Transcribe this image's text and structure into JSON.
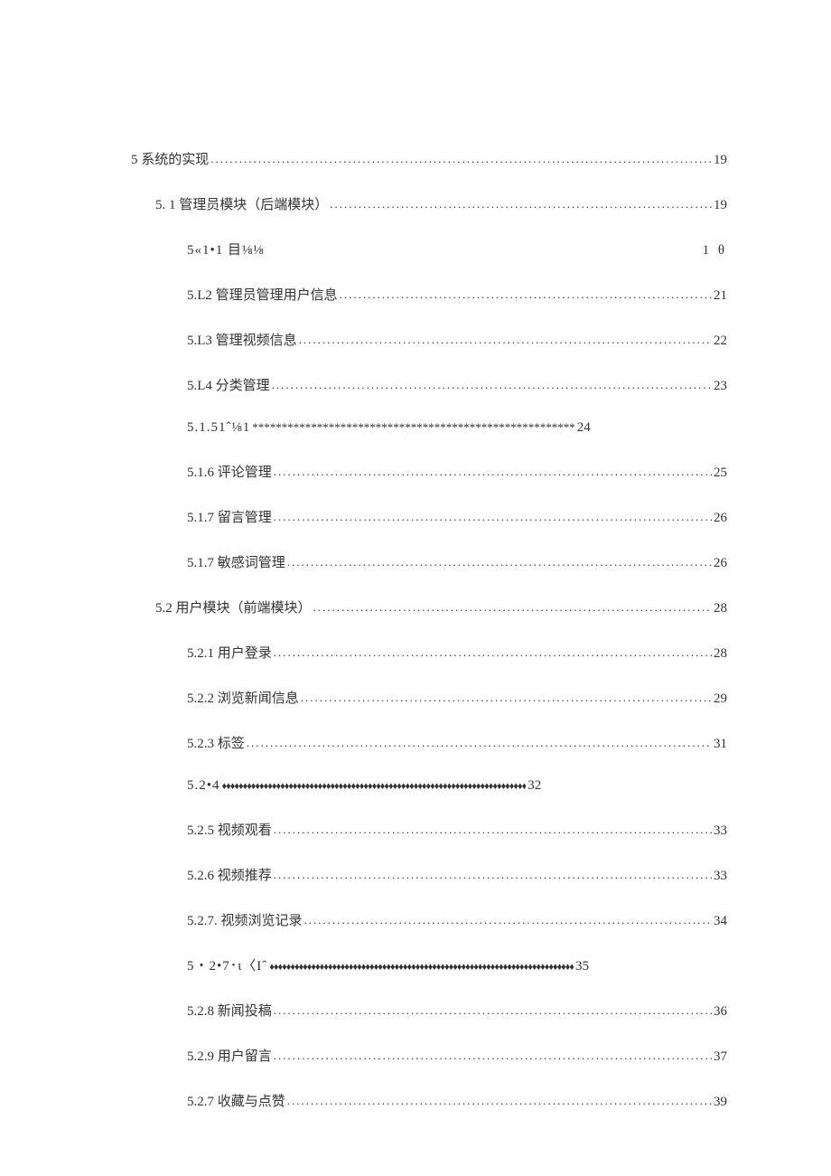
{
  "toc": [
    {
      "level": 0,
      "number": "5",
      "title": "系统的实现",
      "page": "19",
      "leader": "dots"
    },
    {
      "level": 1,
      "number": "5. 1",
      "title": "管理员模块（后端模块）",
      "page": "19",
      "leader": "dots",
      "space_after_number": true
    },
    {
      "level": 2,
      "number": "5«1•1",
      "title": "目⅛⅛",
      "page": "1 θ",
      "leader": "none",
      "special": "511"
    },
    {
      "level": 2,
      "number": "5.L2",
      "title": "管理员管理用户信息",
      "page": "21",
      "leader": "dots"
    },
    {
      "level": 2,
      "number": "5.L3",
      "title": "管理视频信息",
      "page": "22",
      "leader": "dots"
    },
    {
      "level": 2,
      "number": "5.L4",
      "title": "分类管理",
      "page": "23",
      "leader": "dots"
    },
    {
      "level": 2,
      "number": "5.1.51ˆ⅛1",
      "title": "",
      "page": "24",
      "leader": "stars"
    },
    {
      "level": 2,
      "number": "5.1.6",
      "title": "评论管理",
      "page": "25",
      "leader": "dots"
    },
    {
      "level": 2,
      "number": "5.1.7",
      "title": "留言管理",
      "page": "26",
      "leader": "dots"
    },
    {
      "level": 2,
      "number": "5.1.7",
      "title": "敏感词管理",
      "page": "26",
      "leader": "dots"
    },
    {
      "level": 1,
      "number": "5.2",
      "title": "用户模块（前端模块）",
      "page": "28",
      "leader": "dots"
    },
    {
      "level": 2,
      "number": "5.2.1",
      "title": "用户登录",
      "page": "28",
      "leader": "dots"
    },
    {
      "level": 2,
      "number": "5.2.2",
      "title": "浏览新闻信息",
      "page": "29",
      "leader": "dots"
    },
    {
      "level": 2,
      "number": "5.2.3",
      "title": "标签",
      "page": "31",
      "leader": "dots"
    },
    {
      "level": 2,
      "number": "5.2•4",
      "title": "",
      "page": "32",
      "leader": "diamonds",
      "extra_space": true
    },
    {
      "level": 2,
      "number": "5.2.5",
      "title": "视频观看",
      "page": "33",
      "leader": "dots"
    },
    {
      "level": 2,
      "number": "5.2.6",
      "title": "视频推荐",
      "page": "33",
      "leader": "dots"
    },
    {
      "level": 2,
      "number": "5.2.7.",
      "title": "视频浏览记录",
      "page": "34",
      "leader": "dots"
    },
    {
      "level": 2,
      "number": "5・2•7･ι〈Iˆ",
      "title": "",
      "page": "35",
      "leader": "diamonds"
    },
    {
      "level": 2,
      "number": "5.2.8",
      "title": "新闻投稿",
      "page": "36",
      "leader": "dots"
    },
    {
      "level": 2,
      "number": "5.2.9",
      "title": "用户留言",
      "page": "37",
      "leader": "dots"
    },
    {
      "level": 2,
      "number": "5.2.7",
      "title": "收藏与点赞",
      "page": "39",
      "leader": "dots"
    }
  ],
  "leaders": {
    "dots": "................................................................................................................................",
    "stars": "*******************************************************",
    "diamonds": "♦♦♦♦♦♦♦♦♦♦♦♦♦♦♦♦♦♦♦♦♦♦♦♦♦♦♦♦♦♦♦♦♦♦♦♦♦♦♦♦♦♦♦♦♦♦♦♦♦♦♦♦♦♦♦♦♦♦♦♦♦♦♦♦♦♦♦♦♦♦♦♦♦"
  }
}
